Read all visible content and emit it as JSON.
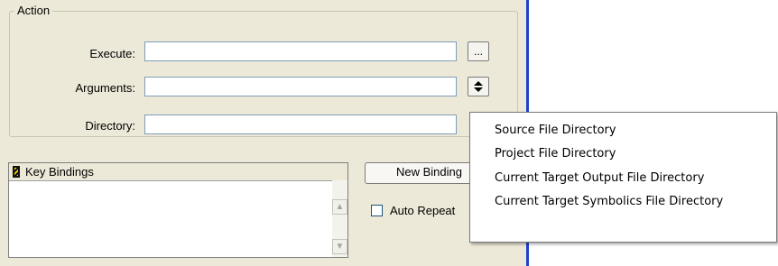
{
  "action_group": {
    "title": "Action",
    "execute_label": "Execute:",
    "execute_value": "",
    "execute_browse_label": "...",
    "arguments_label": "Arguments:",
    "arguments_value": "",
    "arguments_menu_icon": "updown-arrow-icon",
    "directory_label": "Directory:",
    "directory_value": ""
  },
  "key_bindings": {
    "header": "Key Bindings",
    "header_icon": "keyboard-icon",
    "items": []
  },
  "buttons": {
    "new_binding_label": "New Binding"
  },
  "auto_repeat": {
    "label": "Auto Repeat",
    "checked": false
  },
  "context_menu": {
    "items": [
      "Source File Directory",
      "Project File Directory",
      "Current Target Output File Directory",
      "Current Target Symbolics File Directory"
    ]
  },
  "colors": {
    "panel_bg": "#ece9d8",
    "accent_line": "#1f3fd0"
  }
}
